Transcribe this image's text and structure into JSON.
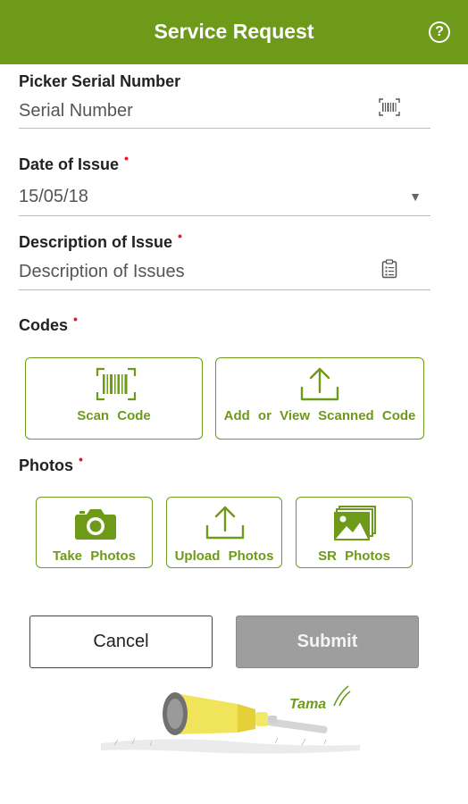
{
  "header": {
    "title": "Service Request",
    "help_glyph": "?"
  },
  "form": {
    "serial": {
      "label": "Picker Serial Number",
      "value": "Serial Number",
      "icon": "barcode-icon"
    },
    "date": {
      "label": "Date of Issue",
      "required": "•",
      "value": "15/05/18",
      "icon": "dropdown-arrow-icon",
      "arrow": "▼"
    },
    "description": {
      "label": "Description of Issue",
      "required": "•",
      "value": "Description of Issues",
      "icon": "clipboard-icon"
    },
    "codes": {
      "label": "Codes",
      "required": "•",
      "scan_label": "Scan Code",
      "view_label": "Add or View Scanned Code"
    },
    "photos": {
      "label": "Photos",
      "required": "•",
      "take_label": "Take Photos",
      "upload_label": "Upload Photos",
      "sr_label": "SR Photos"
    }
  },
  "actions": {
    "cancel_label": "Cancel",
    "submit_label": "Submit"
  },
  "brand": {
    "logo_text": "Tama"
  },
  "colors": {
    "accent": "#6e9a1a",
    "required": "#e5182a",
    "submit_disabled": "#9e9e9e"
  }
}
